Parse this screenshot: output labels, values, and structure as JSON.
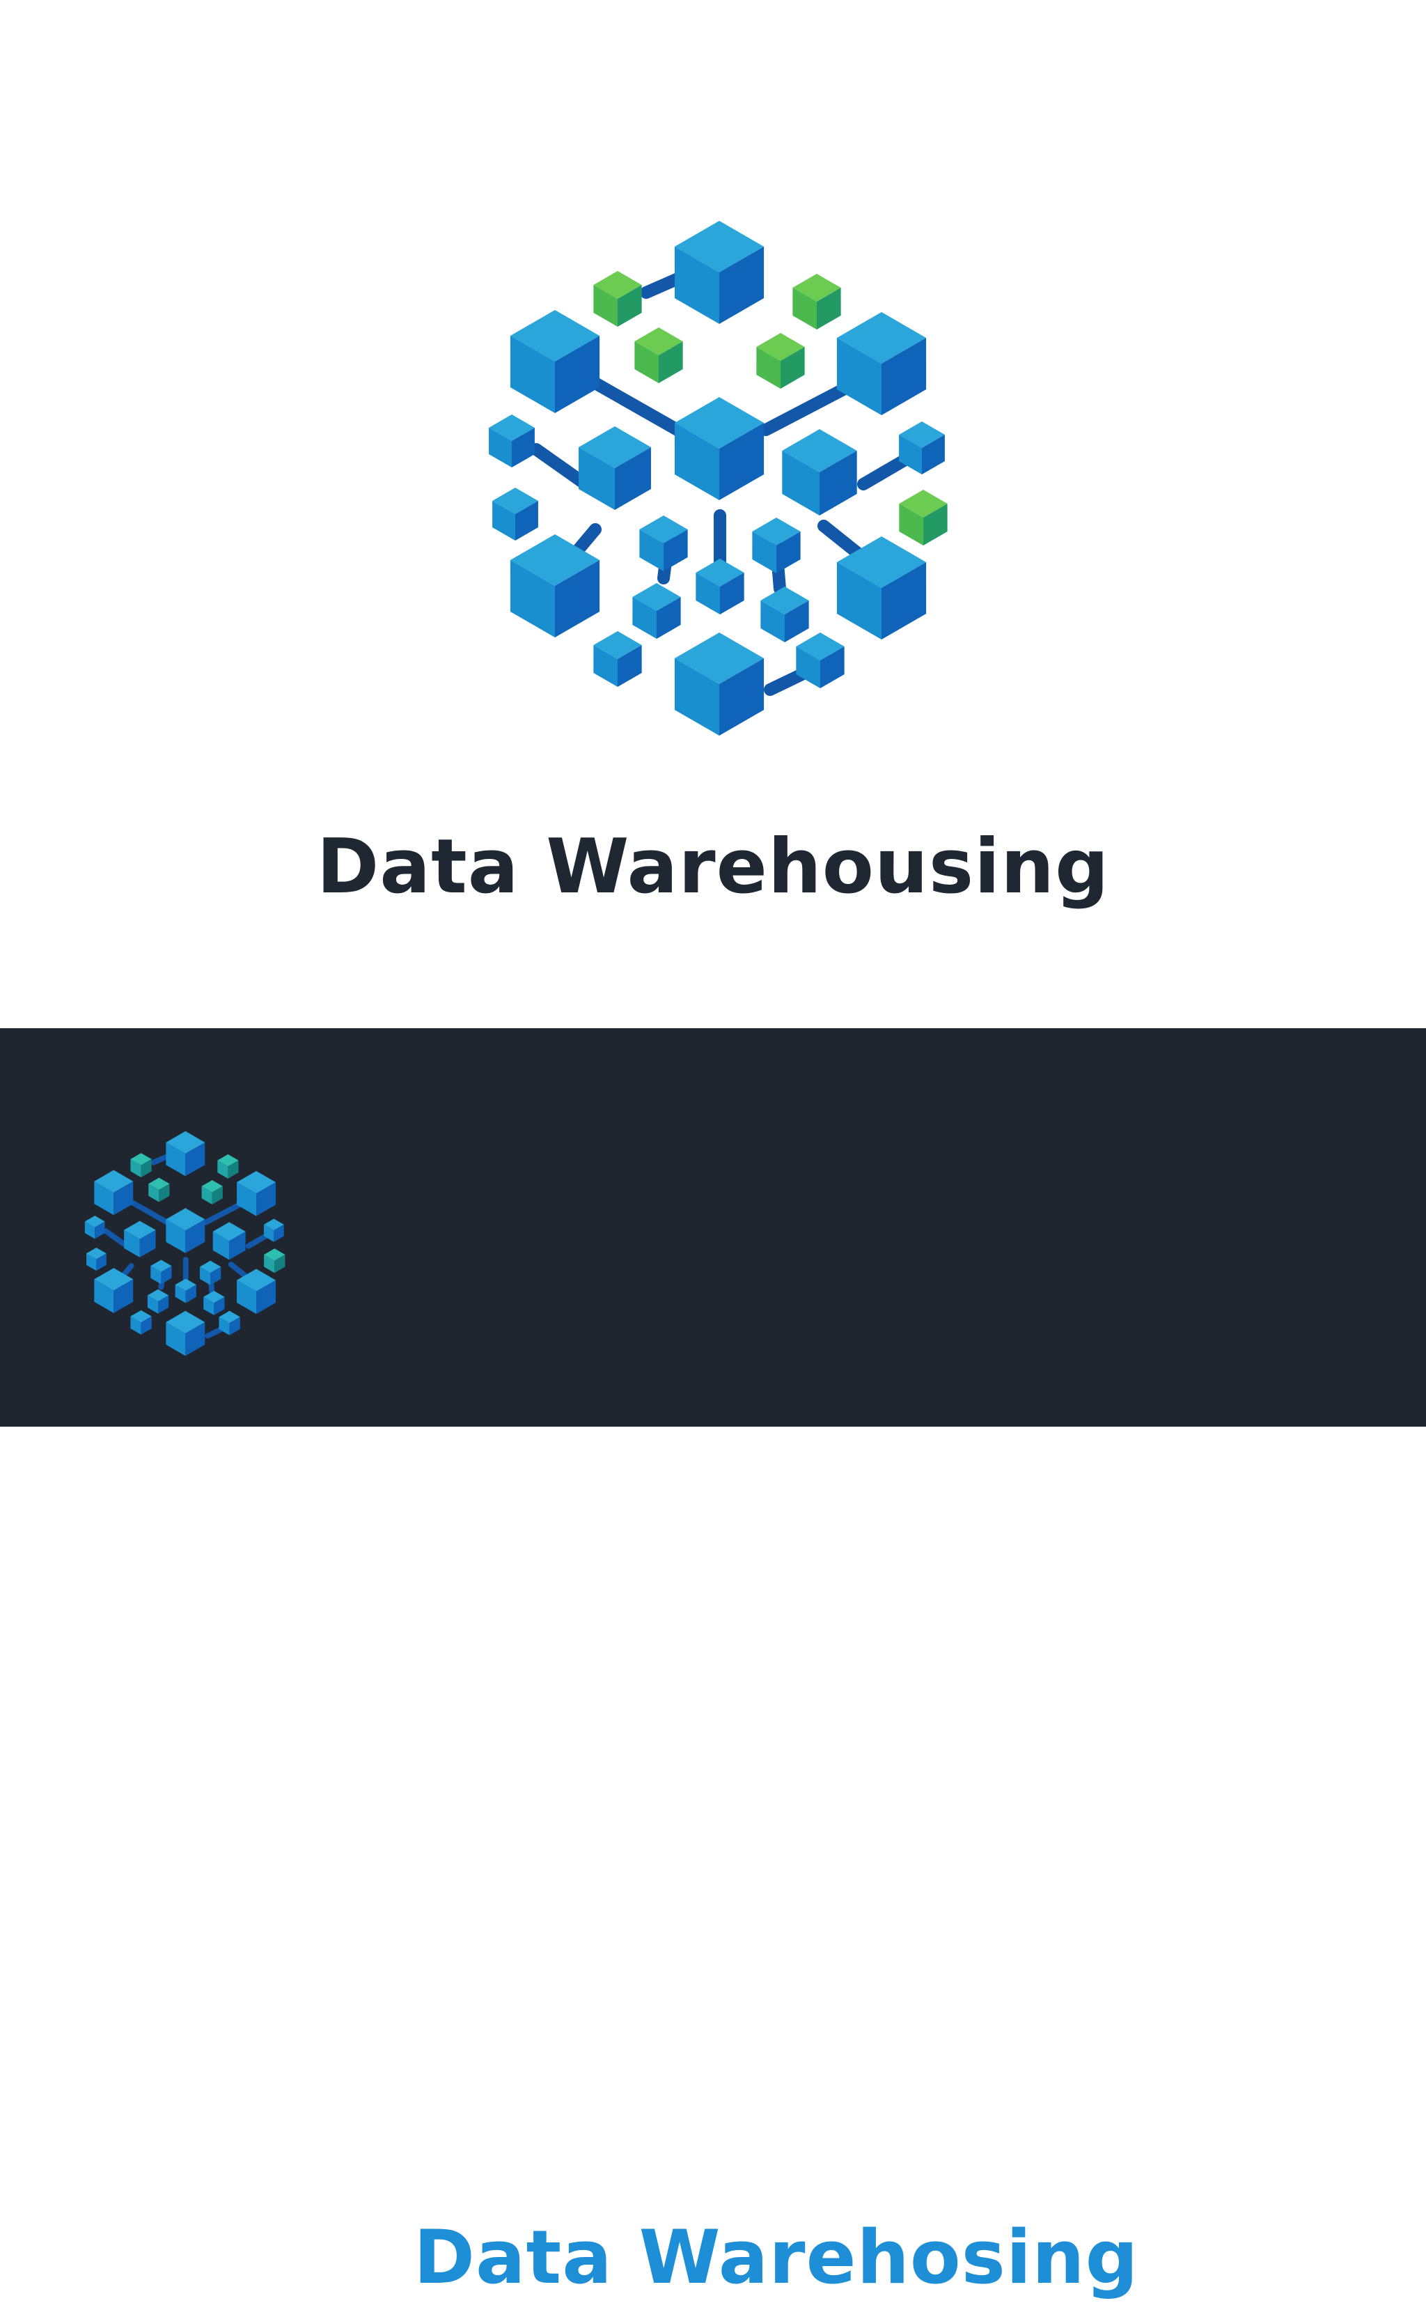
{
  "brand": {
    "primary_title": "Data Warehousing",
    "variant_title": "Data Warehosing"
  },
  "colors": {
    "light_background": "#ffffff",
    "dark_background": "#1f2630",
    "title_dark": "#1f2733",
    "title_accent": "#1e8fd6",
    "cube_top": "#2aa6da",
    "cube_left": "#1a8fd0",
    "cube_right": "#0f63b8",
    "green_top": "#6ccc52",
    "green_left": "#4cb94e",
    "green_right": "#239a63",
    "teal_top": "#2fbfae",
    "teal_left": "#22a5a6",
    "teal_right": "#14807f",
    "connector": "#1257a8"
  },
  "icons": {
    "logo": "data-warehouse-cube-network-icon"
  }
}
